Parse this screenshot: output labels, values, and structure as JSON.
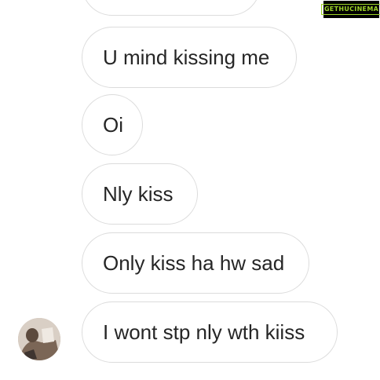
{
  "messages": [
    {
      "text": ""
    },
    {
      "text": "U mind kissing me"
    },
    {
      "text": "Oi"
    },
    {
      "text": "Nly kiss"
    },
    {
      "text": "Only kiss ha hw sad"
    },
    {
      "text": "I wont stp nly wth kiiss"
    }
  ],
  "watermark": {
    "text": "GETHUCINEMA"
  },
  "colors": {
    "bubble_border": "#dcdcdc",
    "text": "#262626",
    "watermark": "#9ed428"
  }
}
